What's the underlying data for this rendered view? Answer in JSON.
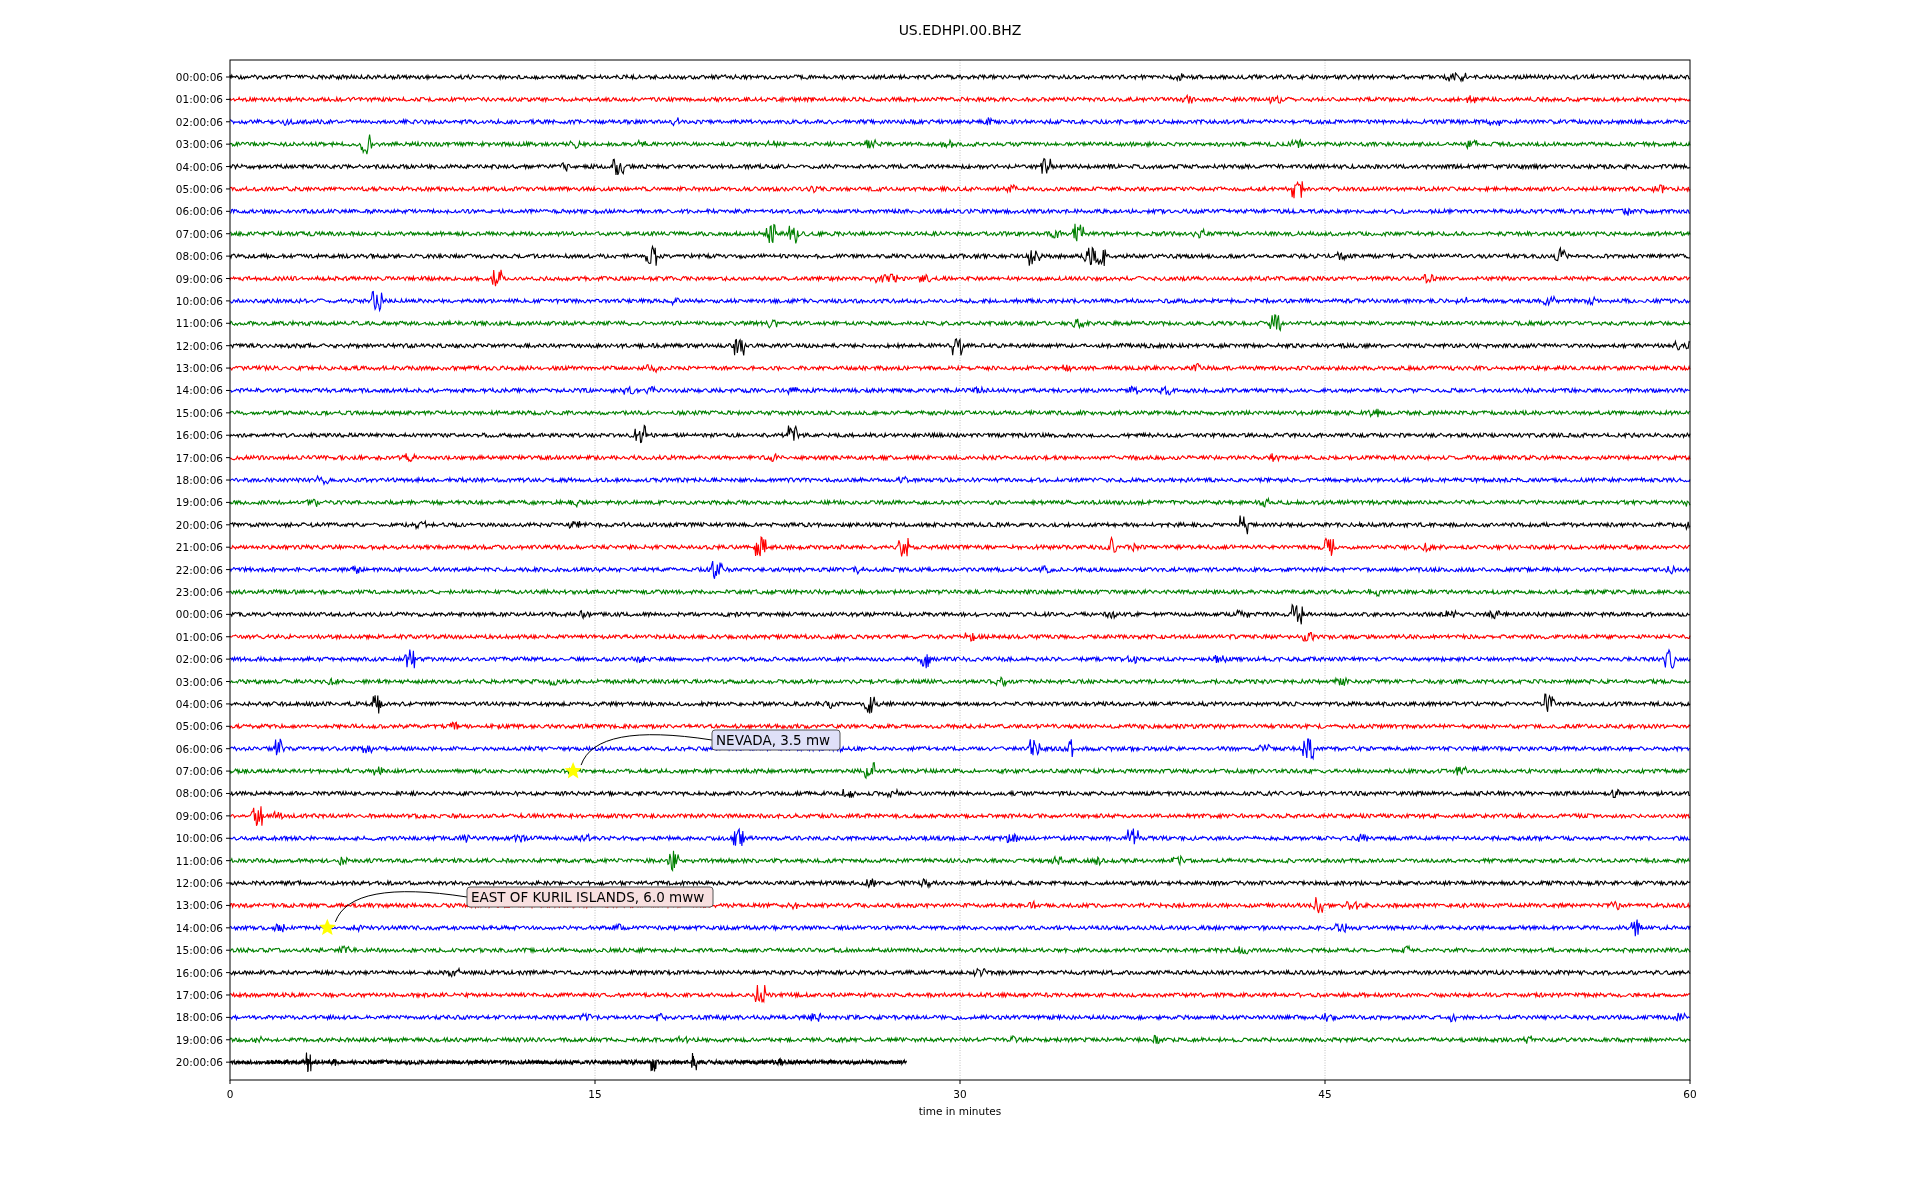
{
  "title": "US.EDHPI.00.BHZ",
  "rows": [
    {
      "label": "00:00:06",
      "color": "#000000"
    },
    {
      "label": "01:00:06",
      "color": "#ff0000"
    },
    {
      "label": "02:00:06",
      "color": "#0000ff"
    },
    {
      "label": "03:00:06",
      "color": "#008000"
    },
    {
      "label": "04:00:06",
      "color": "#000000"
    },
    {
      "label": "05:00:06",
      "color": "#ff0000"
    },
    {
      "label": "06:00:06",
      "color": "#0000ff"
    },
    {
      "label": "07:00:06",
      "color": "#008000"
    },
    {
      "label": "08:00:06",
      "color": "#000000"
    },
    {
      "label": "09:00:06",
      "color": "#ff0000"
    },
    {
      "label": "10:00:06",
      "color": "#0000ff"
    },
    {
      "label": "11:00:06",
      "color": "#008000"
    },
    {
      "label": "12:00:06",
      "color": "#000000"
    },
    {
      "label": "13:00:06",
      "color": "#ff0000"
    },
    {
      "label": "14:00:06",
      "color": "#0000ff"
    },
    {
      "label": "15:00:06",
      "color": "#008000"
    },
    {
      "label": "16:00:06",
      "color": "#000000"
    },
    {
      "label": "17:00:06",
      "color": "#ff0000"
    },
    {
      "label": "18:00:06",
      "color": "#0000ff"
    },
    {
      "label": "19:00:06",
      "color": "#008000"
    },
    {
      "label": "20:00:06",
      "color": "#000000"
    },
    {
      "label": "21:00:06",
      "color": "#ff0000"
    },
    {
      "label": "22:00:06",
      "color": "#0000ff"
    },
    {
      "label": "23:00:06",
      "color": "#008000"
    },
    {
      "label": "00:00:06",
      "color": "#000000"
    },
    {
      "label": "01:00:06",
      "color": "#ff0000"
    },
    {
      "label": "02:00:06",
      "color": "#0000ff"
    },
    {
      "label": "03:00:06",
      "color": "#008000"
    },
    {
      "label": "04:00:06",
      "color": "#000000"
    },
    {
      "label": "05:00:06",
      "color": "#ff0000"
    },
    {
      "label": "06:00:06",
      "color": "#0000ff"
    },
    {
      "label": "07:00:06",
      "color": "#008000"
    },
    {
      "label": "08:00:06",
      "color": "#000000"
    },
    {
      "label": "09:00:06",
      "color": "#ff0000"
    },
    {
      "label": "10:00:06",
      "color": "#0000ff"
    },
    {
      "label": "11:00:06",
      "color": "#008000"
    },
    {
      "label": "12:00:06",
      "color": "#000000"
    },
    {
      "label": "13:00:06",
      "color": "#ff0000"
    },
    {
      "label": "14:00:06",
      "color": "#0000ff"
    },
    {
      "label": "15:00:06",
      "color": "#008000"
    },
    {
      "label": "16:00:06",
      "color": "#000000"
    },
    {
      "label": "17:00:06",
      "color": "#ff0000"
    },
    {
      "label": "18:00:06",
      "color": "#0000ff"
    },
    {
      "label": "19:00:06",
      "color": "#008000"
    },
    {
      "label": "20:00:06",
      "color": "#000000"
    }
  ],
  "xticks": [
    "0",
    "15",
    "30",
    "45",
    "60"
  ],
  "xlabel": "time in minutes",
  "annotations": [
    {
      "text": "NEVADA, 3.5 mw"
    },
    {
      "text": "EAST OF KURIL ISLANDS, 6.0 mww"
    }
  ]
}
